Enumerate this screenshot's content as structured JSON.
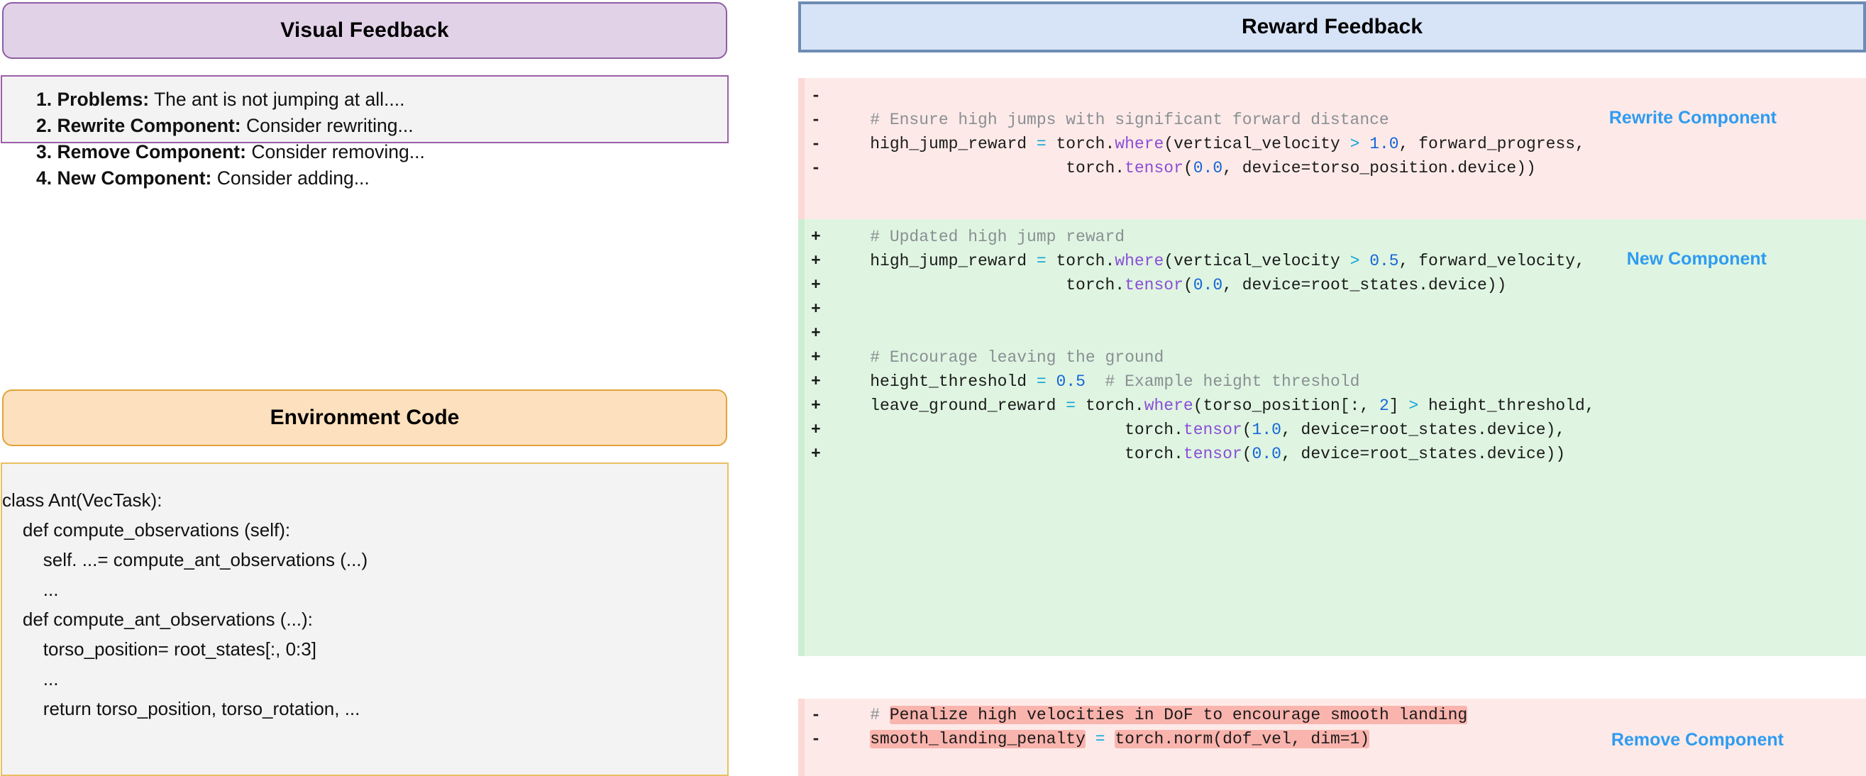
{
  "left": {
    "visual_feedback": {
      "header": "Visual Feedback",
      "items": [
        {
          "label": "1. Problems:",
          "text": " The ant is not jumping at all...."
        },
        {
          "label": "2. Rewrite Component:",
          "text": " Consider rewriting..."
        },
        {
          "label": "3. Remove Component:",
          "text": " Consider removing..."
        },
        {
          "label": "4. New Component:",
          "text": "  Consider adding..."
        }
      ]
    },
    "environment_code": {
      "header": "Environment Code",
      "lines": [
        "class Ant(VecTask):",
        "    def compute_observations (self):",
        "        self. ...= compute_ant_observations (...)",
        "        ...",
        "    def compute_ant_observations (...):",
        "        torso_position= root_states[:, 0:3]",
        "        ...",
        "        return torso_position, torso_rotation, ..."
      ]
    }
  },
  "middle": {
    "model_icon": "openai-logo",
    "arrow_icon": "right-arrow",
    "arrow_color": "#cfdff3"
  },
  "right": {
    "header": "Reward Feedback",
    "tags": {
      "rewrite": "Rewrite Component",
      "new": "New Component",
      "remove": "Remove Component"
    },
    "blocks": [
      {
        "kind": "removed",
        "tag": "Rewrite Component",
        "lines": [
          {
            "sign": "-",
            "text": ""
          },
          {
            "sign": "-",
            "text": "    # Ensure high jumps with significant forward distance"
          },
          {
            "sign": "-",
            "text": "    high_jump_reward = torch.where(vertical_velocity > 1.0, forward_progress,"
          },
          {
            "sign": "-",
            "text": "                        torch.tensor(0.0, device=torso_position.device))"
          }
        ]
      },
      {
        "kind": "added",
        "tag": "New Component",
        "lines": [
          {
            "sign": "+",
            "text": "    # Updated high jump reward"
          },
          {
            "sign": "+",
            "text": "    high_jump_reward = torch.where(vertical_velocity > 0.5, forward_velocity,"
          },
          {
            "sign": "+",
            "text": "                        torch.tensor(0.0, device=root_states.device))"
          },
          {
            "sign": "+",
            "text": ""
          },
          {
            "sign": "+",
            "text": ""
          },
          {
            "sign": "+",
            "text": "    # Encourage leaving the ground"
          },
          {
            "sign": "+",
            "text": "    height_threshold = 0.5  # Example height threshold"
          },
          {
            "sign": "+",
            "text": "    leave_ground_reward = torch.where(torso_position[:, 2] > height_threshold,"
          },
          {
            "sign": "+",
            "text": "                              torch.tensor(1.0, device=root_states.device),"
          },
          {
            "sign": "+",
            "text": "                              torch.tensor(0.0, device=root_states.device))"
          }
        ]
      },
      {
        "kind": "removed",
        "tag": "Remove Component",
        "lines": [
          {
            "sign": "-",
            "text": "    # Penalize high velocities in DoF to encourage smooth landing"
          },
          {
            "sign": "-",
            "text": "    smooth_landing_penalty = torch.norm(dof_vel, dim=1)"
          }
        ]
      }
    ]
  },
  "colors": {
    "visual_header_bg": "#e2d2e8",
    "visual_header_border": "#8e5ea2",
    "env_header_bg": "#fde0bd",
    "env_header_border": "#e0a33a",
    "reward_header_bg": "#d7e4f7",
    "reward_header_border": "#6d8cb4",
    "diff_removed_bg": "#fdeae8",
    "diff_added_bg": "#dff5e1",
    "highlight_bg": "#fab4ae",
    "tag_color": "#2f9bf0"
  }
}
